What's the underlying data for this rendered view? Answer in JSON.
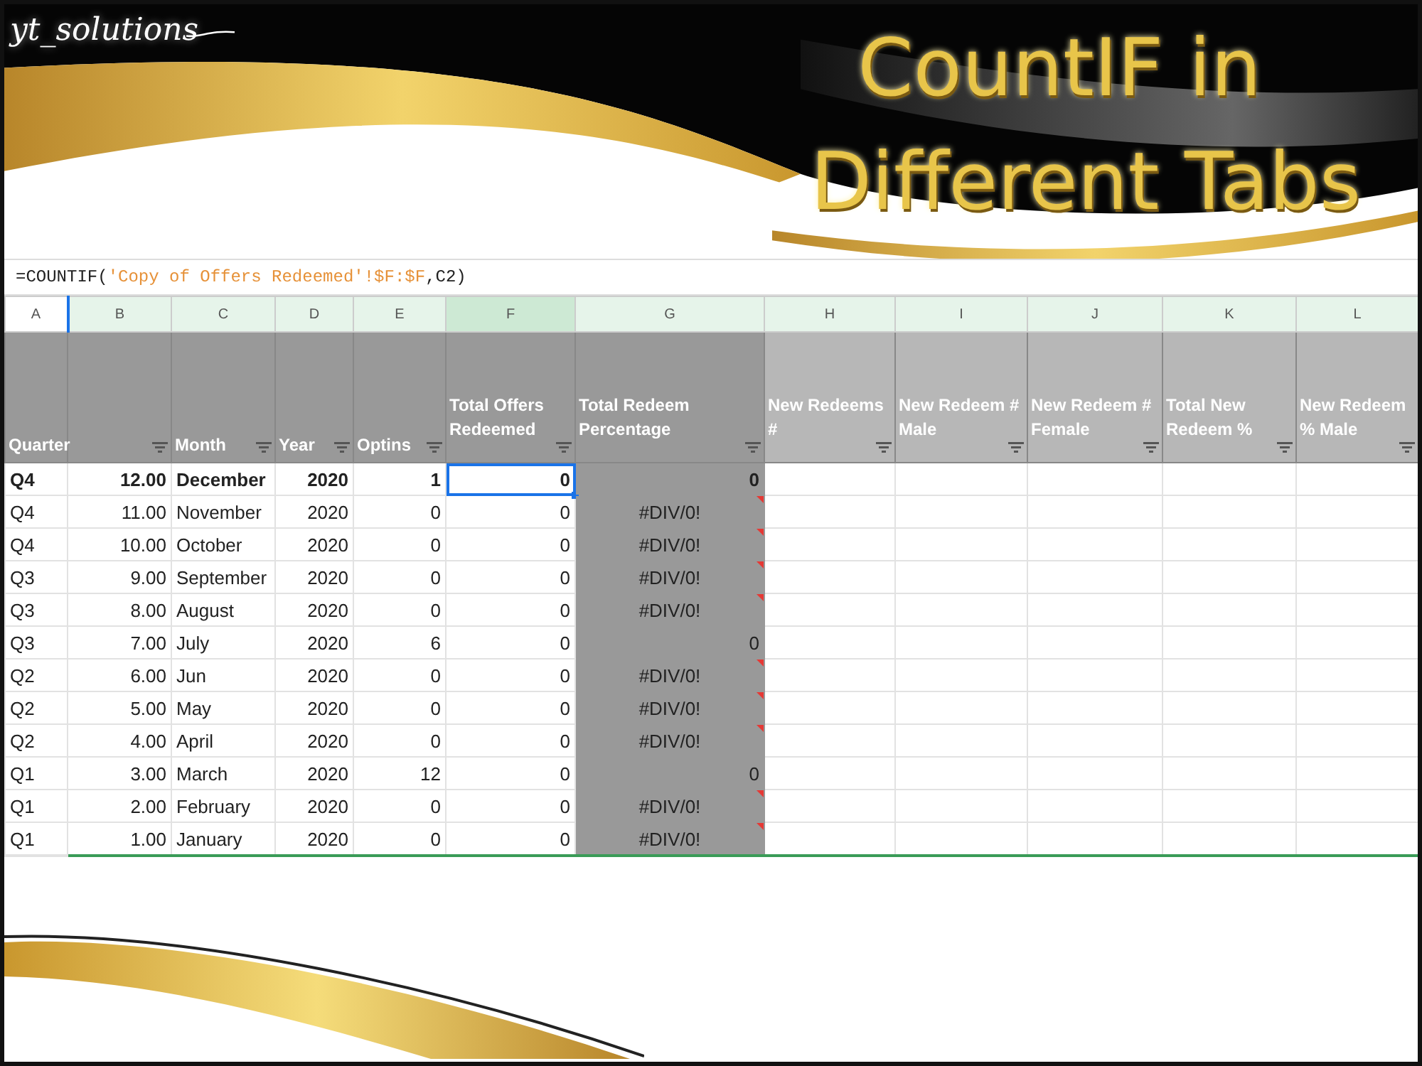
{
  "banner": {
    "logo": "yt_solutions",
    "title_lines": [
      "CountIF in",
      "Different Tabs"
    ]
  },
  "formula_bar": {
    "formula": "=COUNTIF(",
    "formula_reference": "'Copy of Offers Redeemed'!$F:$F",
    "formula_rest": ",C2)"
  },
  "columns": [
    {
      "letter": "A",
      "highlighted": false,
      "selected": false
    },
    {
      "letter": "B",
      "highlighted": true,
      "selected": false
    },
    {
      "letter": "C",
      "highlighted": true,
      "selected": false
    },
    {
      "letter": "D",
      "highlighted": true,
      "selected": false
    },
    {
      "letter": "E",
      "highlighted": true,
      "selected": false
    },
    {
      "letter": "F",
      "highlighted": true,
      "selected": true
    },
    {
      "letter": "G",
      "highlighted": true,
      "selected": false
    },
    {
      "letter": "H",
      "highlighted": true,
      "selected": false
    },
    {
      "letter": "I",
      "highlighted": true,
      "selected": false
    },
    {
      "letter": "J",
      "highlighted": true,
      "selected": false
    },
    {
      "letter": "K",
      "highlighted": true,
      "selected": false
    },
    {
      "letter": "L",
      "highlighted": true,
      "selected": false
    }
  ],
  "header_row": [
    {
      "label": "Quarter",
      "kind": "dark",
      "filter": false
    },
    {
      "kind": "dark",
      "filter": true
    },
    {
      "label": "Month",
      "kind": "dark",
      "filter": true
    },
    {
      "label": "Year",
      "kind": "dark",
      "filter": true
    },
    {
      "label": "Optins",
      "kind": "dark",
      "filter": true
    },
    {
      "label": "Total Offers Redeemed",
      "kind": "dark",
      "filter": true
    },
    {
      "label": "Total Redeem Percentage",
      "kind": "dark",
      "filter": true
    },
    {
      "label": "New Redeems #",
      "kind": "light",
      "filter": true
    },
    {
      "label": "New Redeem # Male",
      "kind": "light",
      "filter": true
    },
    {
      "label": "New Redeem # Female",
      "kind": "light",
      "filter": true
    },
    {
      "label": "Total New Redeem %",
      "kind": "light",
      "filter": true
    },
    {
      "label": "New Redeem % Male",
      "kind": "light",
      "filter": true
    }
  ],
  "rows": [
    {
      "quarter": "Q4",
      "number": "12.00",
      "month": "December",
      "year": "2020",
      "optins": "1",
      "redeemed": "0",
      "percentage": "0",
      "bold": true,
      "error": false,
      "redeemed_selected": true
    },
    {
      "quarter": "Q4",
      "number": "11.00",
      "month": "November",
      "year": "2020",
      "optins": "0",
      "redeemed": "0",
      "percentage": "#DIV/0!",
      "bold": false,
      "error": true,
      "redeemed_selected": false
    },
    {
      "quarter": "Q4",
      "number": "10.00",
      "month": "October",
      "year": "2020",
      "optins": "0",
      "redeemed": "0",
      "percentage": "#DIV/0!",
      "bold": false,
      "error": true,
      "redeemed_selected": false
    },
    {
      "quarter": "Q3",
      "number": "9.00",
      "month": "September",
      "year": "2020",
      "optins": "0",
      "redeemed": "0",
      "percentage": "#DIV/0!",
      "bold": false,
      "error": true,
      "redeemed_selected": false
    },
    {
      "quarter": "Q3",
      "number": "8.00",
      "month": "August",
      "year": "2020",
      "optins": "0",
      "redeemed": "0",
      "percentage": "#DIV/0!",
      "bold": false,
      "error": true,
      "redeemed_selected": false
    },
    {
      "quarter": "Q3",
      "number": "7.00",
      "month": "July",
      "year": "2020",
      "optins": "6",
      "redeemed": "0",
      "percentage": "0",
      "bold": false,
      "error": false,
      "redeemed_selected": false
    },
    {
      "quarter": "Q2",
      "number": "6.00",
      "month": "Jun",
      "year": "2020",
      "optins": "0",
      "redeemed": "0",
      "percentage": "#DIV/0!",
      "bold": false,
      "error": true,
      "redeemed_selected": false
    },
    {
      "quarter": "Q2",
      "number": "5.00",
      "month": "May",
      "year": "2020",
      "optins": "0",
      "redeemed": "0",
      "percentage": "#DIV/0!",
      "bold": false,
      "error": true,
      "redeemed_selected": false
    },
    {
      "quarter": "Q2",
      "number": "4.00",
      "month": "April",
      "year": "2020",
      "optins": "0",
      "redeemed": "0",
      "percentage": "#DIV/0!",
      "bold": false,
      "error": true,
      "redeemed_selected": false
    },
    {
      "quarter": "Q1",
      "number": "3.00",
      "month": "March",
      "year": "2020",
      "optins": "12",
      "redeemed": "0",
      "percentage": "0",
      "bold": false,
      "error": false,
      "redeemed_selected": false
    },
    {
      "quarter": "Q1",
      "number": "2.00",
      "month": "February",
      "year": "2020",
      "optins": "0",
      "redeemed": "0",
      "percentage": "#DIV/0!",
      "bold": false,
      "error": true,
      "redeemed_selected": false
    },
    {
      "quarter": "Q1",
      "number": "1.00",
      "month": "January",
      "year": "2020",
      "optins": "0",
      "redeemed": "0",
      "percentage": "#DIV/0!",
      "bold": false,
      "error": true,
      "redeemed_selected": false
    }
  ]
}
